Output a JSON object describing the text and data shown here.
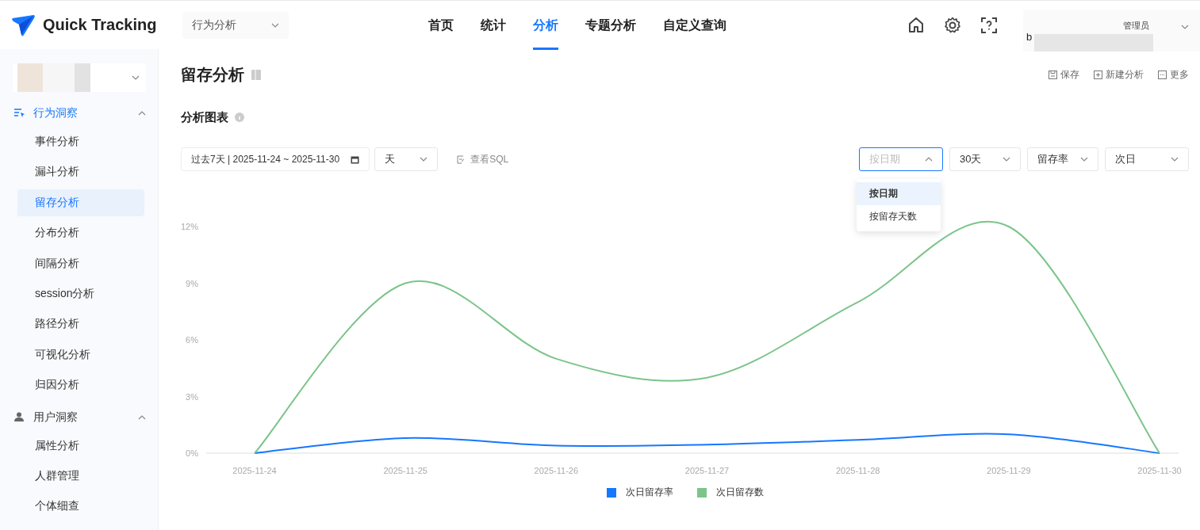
{
  "header": {
    "logo": "Quick Tracking",
    "module_select": {
      "value": "行为分析"
    },
    "nav": [
      {
        "label": "首页",
        "selected": false
      },
      {
        "label": "统计",
        "selected": false
      },
      {
        "label": "分析",
        "selected": true
      },
      {
        "label": "专题分析",
        "selected": false
      },
      {
        "label": "自定义查询",
        "selected": false
      }
    ],
    "user": {
      "role": "管理员",
      "name": "b"
    }
  },
  "sidebar": {
    "groups": [
      {
        "label": "行为洞察",
        "selected": true,
        "expanded": true,
        "items": [
          {
            "label": "事件分析",
            "selected": false
          },
          {
            "label": "漏斗分析",
            "selected": false
          },
          {
            "label": "留存分析",
            "selected": true
          },
          {
            "label": "分布分析",
            "selected": false
          },
          {
            "label": "间隔分析",
            "selected": false
          },
          {
            "label": "session分析",
            "selected": false
          },
          {
            "label": "路径分析",
            "selected": false
          },
          {
            "label": "可视化分析",
            "selected": false
          },
          {
            "label": "归因分析",
            "selected": false
          }
        ]
      },
      {
        "label": "用户洞察",
        "selected": false,
        "expanded": true,
        "items": [
          {
            "label": "属性分析",
            "selected": false
          },
          {
            "label": "人群管理",
            "selected": false
          },
          {
            "label": "个体细查",
            "selected": false
          }
        ]
      }
    ]
  },
  "page": {
    "title": "留存分析",
    "actions": [
      {
        "kind": "save",
        "label": "保存"
      },
      {
        "kind": "new",
        "label": "新建分析"
      },
      {
        "kind": "more",
        "label": "更多"
      }
    ]
  },
  "section": {
    "title": "分析图表",
    "date_range": "过去7天 | 2025-11-24 ~ 2025-11-30",
    "granularity": "天",
    "sql_link": "查看SQL",
    "filters": [
      {
        "placeholder": "按日期",
        "expanded": true
      },
      {
        "value": "30天",
        "expanded": false
      },
      {
        "value": "留存率",
        "expanded": false
      },
      {
        "value": "次日",
        "expanded": false
      }
    ],
    "dropdown": [
      {
        "label": "按日期",
        "selected": true
      },
      {
        "label": "按留存天数",
        "selected": false
      }
    ],
    "chart_data": {
      "type": "line",
      "legend": "bottom",
      "categories": [
        "2025-11-24",
        "2025-11-25",
        "2025-11-26",
        "2025-11-27",
        "2025-11-28",
        "2025-11-29",
        "2025-11-30"
      ],
      "ylim": [
        0,
        12
      ],
      "yticks": [
        {
          "value": 0,
          "label": "0%"
        },
        {
          "value": 3,
          "label": "3%"
        },
        {
          "value": 6,
          "label": "6%"
        },
        {
          "value": 9,
          "label": "9%"
        },
        {
          "value": 12,
          "label": "12%"
        }
      ],
      "series": [
        {
          "name": "次日留存率",
          "color": "#1677ff",
          "values": [
            0,
            0.8,
            0.4,
            0.45,
            0.7,
            1.0,
            0
          ]
        },
        {
          "name": "次日留存数",
          "color": "#7cc48a",
          "values": [
            0,
            9,
            5,
            4,
            8,
            12,
            0
          ]
        }
      ]
    }
  }
}
